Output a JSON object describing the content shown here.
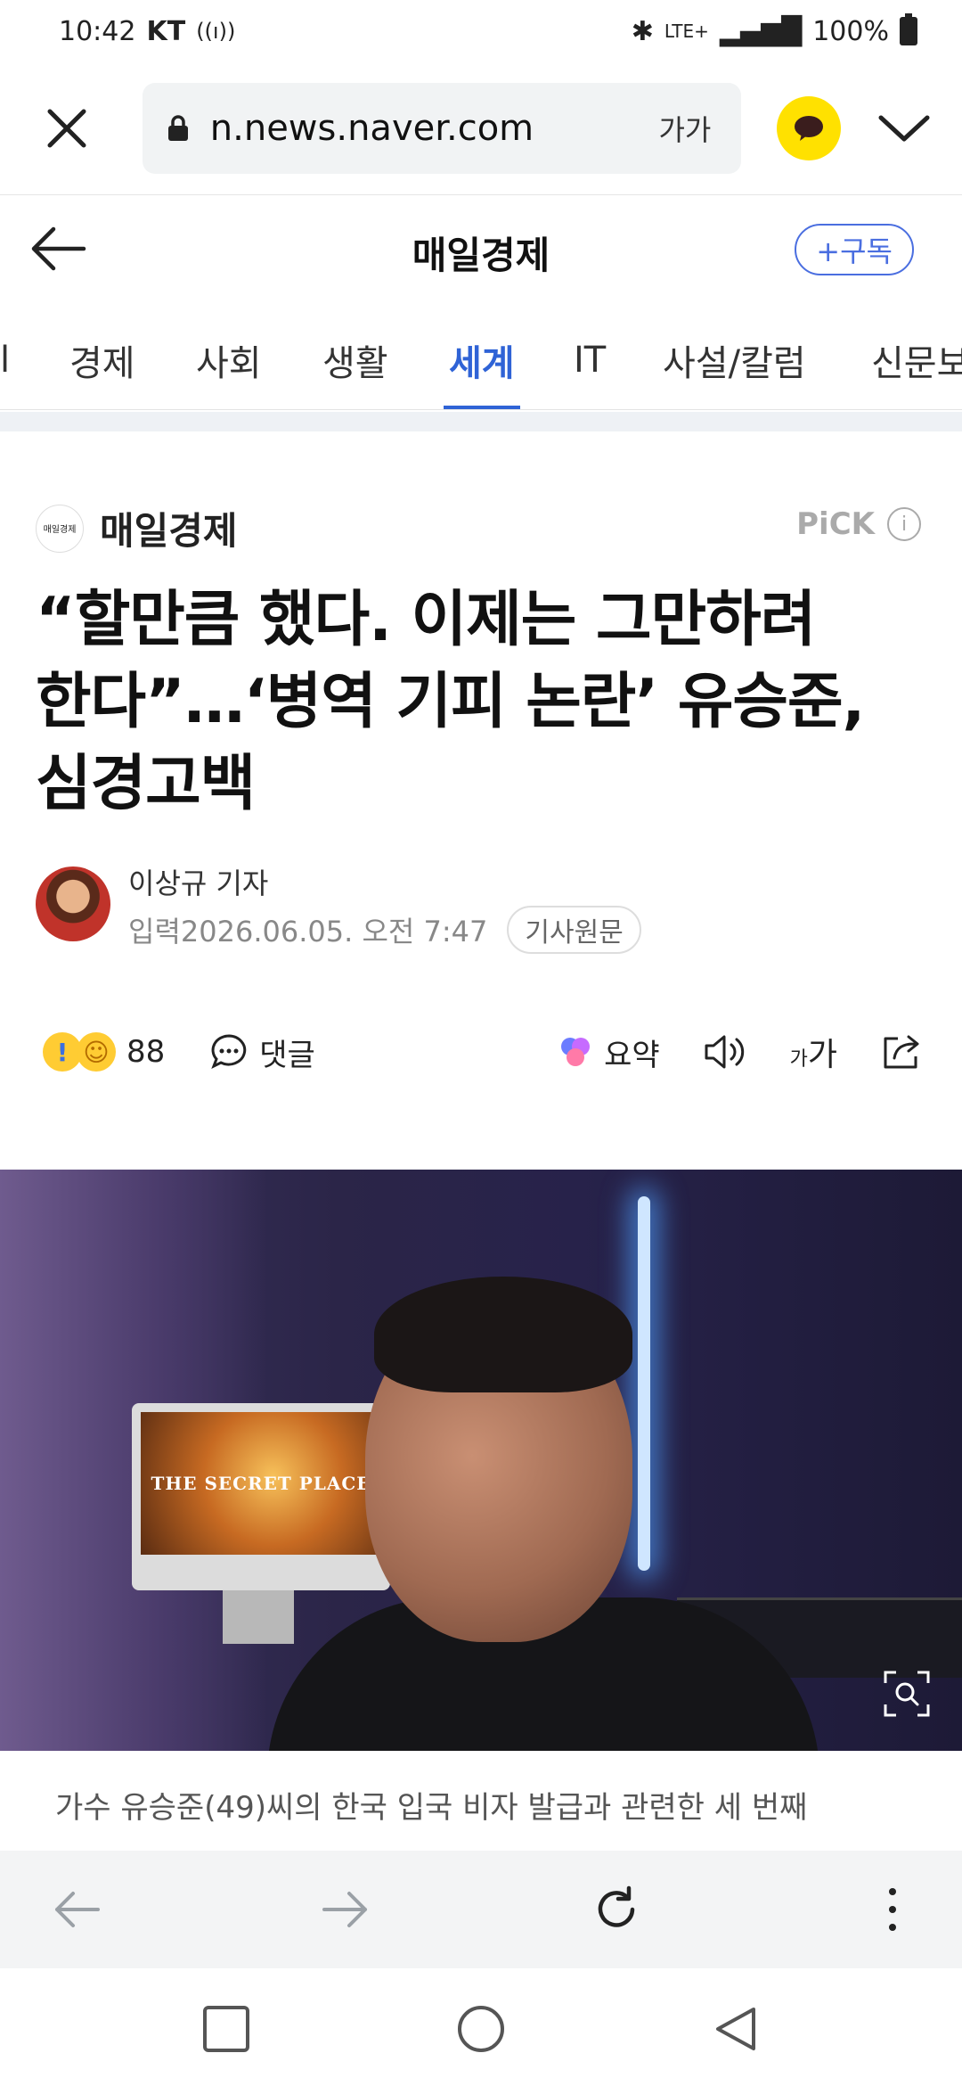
{
  "status_bar": {
    "time": "10:42",
    "carrier": "KT",
    "network": "LTE+",
    "battery": "100%"
  },
  "browser": {
    "url": "n.news.naver.com",
    "text_size_label": "가가"
  },
  "header": {
    "title": "매일경제",
    "subscribe_label": "+구독"
  },
  "tabs": [
    {
      "label": "l"
    },
    {
      "label": "경제"
    },
    {
      "label": "사회"
    },
    {
      "label": "생활"
    },
    {
      "label": "세계",
      "active": true
    },
    {
      "label": "IT"
    },
    {
      "label": "사설/칼럼"
    },
    {
      "label": "신문보"
    }
  ],
  "article": {
    "press_name": "매일경제",
    "press_logo_text": "매일경제",
    "pick_label": "PiCK",
    "headline_lines": [
      "“할만큼 했다. 이제는 그만하려",
      "한다”…‘병역 기피 논란’ 유승준,",
      "심경고백"
    ],
    "reporter": "이상규 기자",
    "published_label": "입력",
    "published": "2026.06.05. 오전 7:47",
    "original_link_label": "기사원문",
    "reaction_count": "88",
    "comment_label": "댓글",
    "summary_label": "요약",
    "fontsize_small": "가",
    "fontsize_large": "가",
    "image_text": "THE SECRET PLACE",
    "body_preview": "가수 유승준(49)씨의 한국 입국 비자 발급과 관련한 세 번째"
  },
  "colors": {
    "accent": "#2f63d6",
    "subscribe": "#4a6ee0",
    "kakao": "#ffe100"
  }
}
